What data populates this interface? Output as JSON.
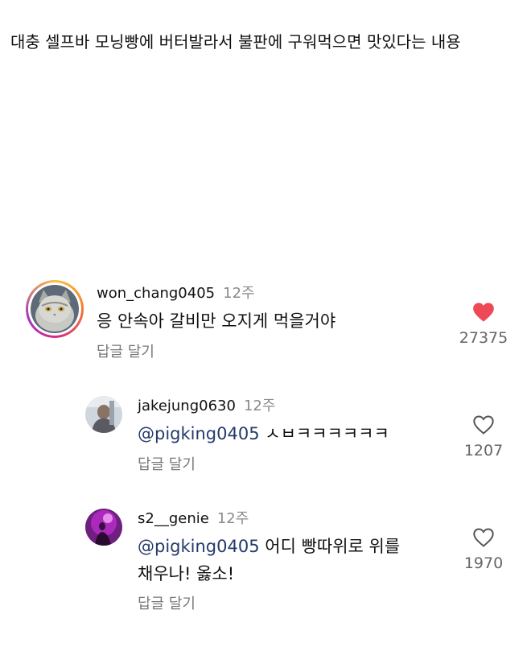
{
  "post": {
    "caption": "대충 셀프바 모닝빵에 버터발라서 불판에 구워먹으면 맛있다는 내용"
  },
  "comments": [
    {
      "username": "won_chang0405",
      "time": "12주",
      "text": "응 안속아 갈비만 오지게 먹을거야",
      "reply_label": "답글 달기",
      "likes": "27375",
      "liked": true,
      "avatar_icon": "gray-cat-avatar",
      "has_story_ring": true
    },
    {
      "username": "jakejung0630",
      "time": "12주",
      "mention": "@pigking0405",
      "text": " ㅅㅂㅋㅋㅋㅋㅋㅋ",
      "reply_label": "답글 달기",
      "likes": "1207",
      "liked": false,
      "avatar_icon": "person-photo-avatar"
    },
    {
      "username": "s2__genie",
      "time": "12주",
      "mention": "@pigking0405",
      "text_line1": " 어디 빵따위로 위를",
      "text_line2": "채우나! 옳소!",
      "reply_label": "답글 달기",
      "likes": "1970",
      "liked": false,
      "avatar_icon": "purple-stage-avatar"
    }
  ],
  "colors": {
    "like_active": "#ed4956",
    "mention": "#233a6b",
    "secondary_text": "#8a8a8a"
  }
}
